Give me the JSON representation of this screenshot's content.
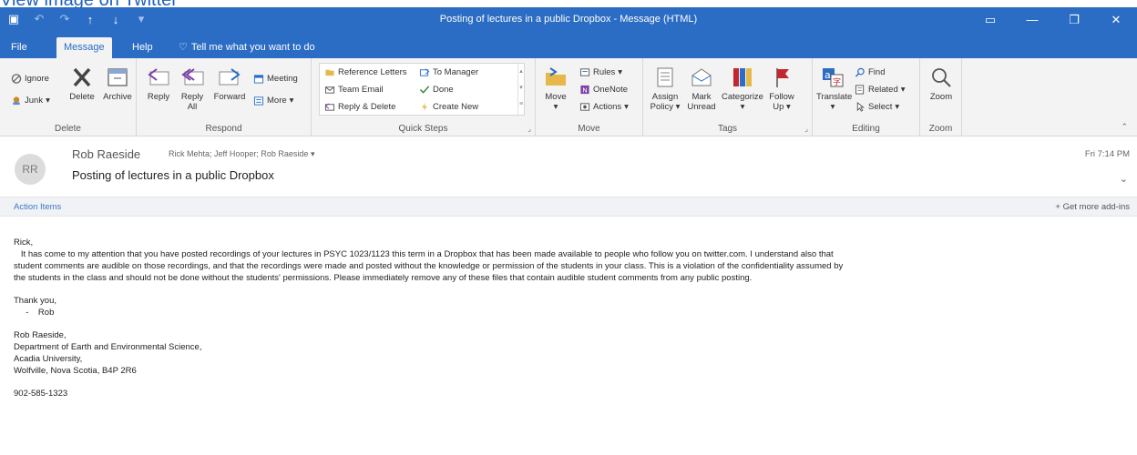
{
  "overlay_caption": "View image on Twitter",
  "window": {
    "title": "Posting of lectures in a public Dropbox - Message (HTML)",
    "controls": {
      "ribbon": "▭",
      "minimize": "—",
      "restore": "❐",
      "close": "✕"
    }
  },
  "tabs": {
    "file": "File",
    "message": "Message",
    "help": "Help",
    "tell_me": "Tell me what you want to do"
  },
  "ribbon": {
    "delete": {
      "label": "Delete",
      "ignore": "Ignore",
      "junk": "Junk",
      "delete_btn": "Delete",
      "archive": "Archive"
    },
    "respond": {
      "label": "Respond",
      "reply": "Reply",
      "reply_all_1": "Reply",
      "reply_all_2": "All",
      "forward": "Forward",
      "meeting": "Meeting",
      "more": "More"
    },
    "quick_steps": {
      "label": "Quick Steps",
      "items": [
        "Reference Letters",
        "To Manager",
        "Team Email",
        "Done",
        "Reply & Delete",
        "Create New"
      ]
    },
    "move": {
      "label": "Move",
      "move": "Move",
      "rules": "Rules",
      "onenote": "OneNote",
      "actions": "Actions"
    },
    "tags": {
      "label": "Tags",
      "assign_1": "Assign",
      "assign_2": "Policy",
      "mark_1": "Mark",
      "mark_2": "Unread",
      "categorize": "Categorize",
      "follow_1": "Follow",
      "follow_2": "Up"
    },
    "editing": {
      "label": "Editing",
      "translate": "Translate",
      "find": "Find",
      "related": "Related",
      "select": "Select"
    },
    "zoom": {
      "label": "Zoom",
      "zoom": "Zoom"
    }
  },
  "message": {
    "avatar_initials": "RR",
    "sender": "Rob Raeside",
    "recipients": "Rick Mehta; Jeff Hooper; Rob Raeside",
    "subject": "Posting of lectures in a public Dropbox",
    "date": "Fri 7:14 PM"
  },
  "action_bar": {
    "action_items": "Action Items",
    "get_addins": "+ Get more add-ins"
  },
  "body": {
    "greeting": "Rick,",
    "line1": "   It has come to my attention that you have posted recordings of your lectures in PSYC 1023/1123 this term in a Dropbox that has been made available to people who follow you on twitter.com. I understand also that",
    "line2": "student comments are audible on those recordings, and that the recordings were made and posted without the knowledge or permission of the students in your class. This is a violation of the confidentiality assumed by",
    "line3": "the students in the class and should not be done without the students' permissions. Please immediately remove any of these files that contain audible student comments from any public posting.",
    "thanks": "Thank you,",
    "sign": "     -    Rob",
    "sig_name": "Rob Raeside,",
    "sig_dept": "Department of Earth and Environmental Science,",
    "sig_univ": "Acadia University,",
    "sig_addr": "Wolfville, Nova Scotia, B4P 2R6",
    "sig_phone": "902-585-1323"
  },
  "colors": {
    "title_blue": "#2b6cc4",
    "ribbon_bg": "#f3f3f3",
    "accent_red": "#c4262e"
  }
}
